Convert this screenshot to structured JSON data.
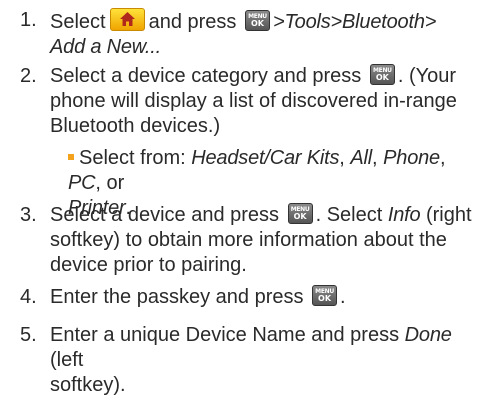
{
  "steps": [
    {
      "num": "1.",
      "lines": [
        {
          "t1": "Select",
          "t2": "and press",
          "t3": ">Tools>Bluetooth>"
        },
        {
          "em": "Add a New..."
        }
      ]
    },
    {
      "num": "2.",
      "lines": [
        {
          "t1": "Select a device category and press",
          "t2": ". (Your"
        },
        {
          "text": "phone will display a list of discovered in-range"
        },
        {
          "text": "Bluetooth devices.)"
        }
      ],
      "sub": {
        "label": "Select from:",
        "opt1": "Headset/Car Kits",
        "sep1": ",",
        "opt2": "All",
        "sep2": ",",
        "opt3": "Phone",
        "sep3": ",",
        "opt4": "PC",
        "sep4": ", or",
        "opt5": "Printer",
        "end": "."
      }
    },
    {
      "num": "3.",
      "lines": [
        {
          "t1": "Select a device and press",
          "t2": ". Select",
          "em": "Info",
          "t3": "(right"
        },
        {
          "text": "softkey) to obtain more information about the"
        },
        {
          "text": "device prior to pairing."
        }
      ]
    },
    {
      "num": "4.",
      "lines": [
        {
          "t1": "Enter the passkey and press",
          "t2": "."
        }
      ]
    },
    {
      "num": "5.",
      "lines": [
        {
          "t1": "Enter a unique Device Name and press",
          "em": "Done",
          "t2": "(left"
        },
        {
          "text": "softkey)."
        }
      ]
    }
  ],
  "keys": {
    "menu_top": "MENU",
    "menu_bottom": "OK"
  },
  "icons": {
    "home": "home-icon",
    "menu_ok": "menu-ok-key-icon"
  },
  "colors": {
    "home_key": "#f5b800",
    "bullet": "#f2a31b",
    "text": "#2a2a2a"
  }
}
